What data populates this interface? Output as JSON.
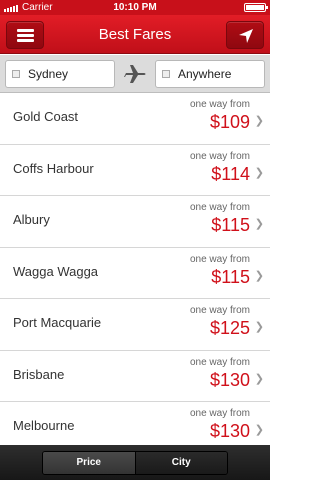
{
  "status_bar": {
    "carrier": "Carrier",
    "time": "10:10 PM"
  },
  "nav": {
    "title": "Best Fares",
    "menu_icon": "hamburger-icon",
    "location_icon": "location-arrow-icon"
  },
  "route": {
    "from": "Sydney",
    "to": "Anywhere",
    "plane_icon": "plane-icon"
  },
  "fares": [
    {
      "city": "Gold Coast",
      "label": "one way from",
      "price": "$109"
    },
    {
      "city": "Coffs Harbour",
      "label": "one way from",
      "price": "$114"
    },
    {
      "city": "Albury",
      "label": "one way from",
      "price": "$115"
    },
    {
      "city": "Wagga Wagga",
      "label": "one way from",
      "price": "$115"
    },
    {
      "city": "Port Macquarie",
      "label": "one way from",
      "price": "$125"
    },
    {
      "city": "Brisbane",
      "label": "one way from",
      "price": "$130"
    },
    {
      "city": "Melbourne",
      "label": "one way from",
      "price": "$130"
    }
  ],
  "sort": {
    "tabs": [
      "Price",
      "City"
    ],
    "selected": "Price"
  },
  "colors": {
    "brand_red": "#c8101a",
    "price_red": "#d0101a"
  }
}
